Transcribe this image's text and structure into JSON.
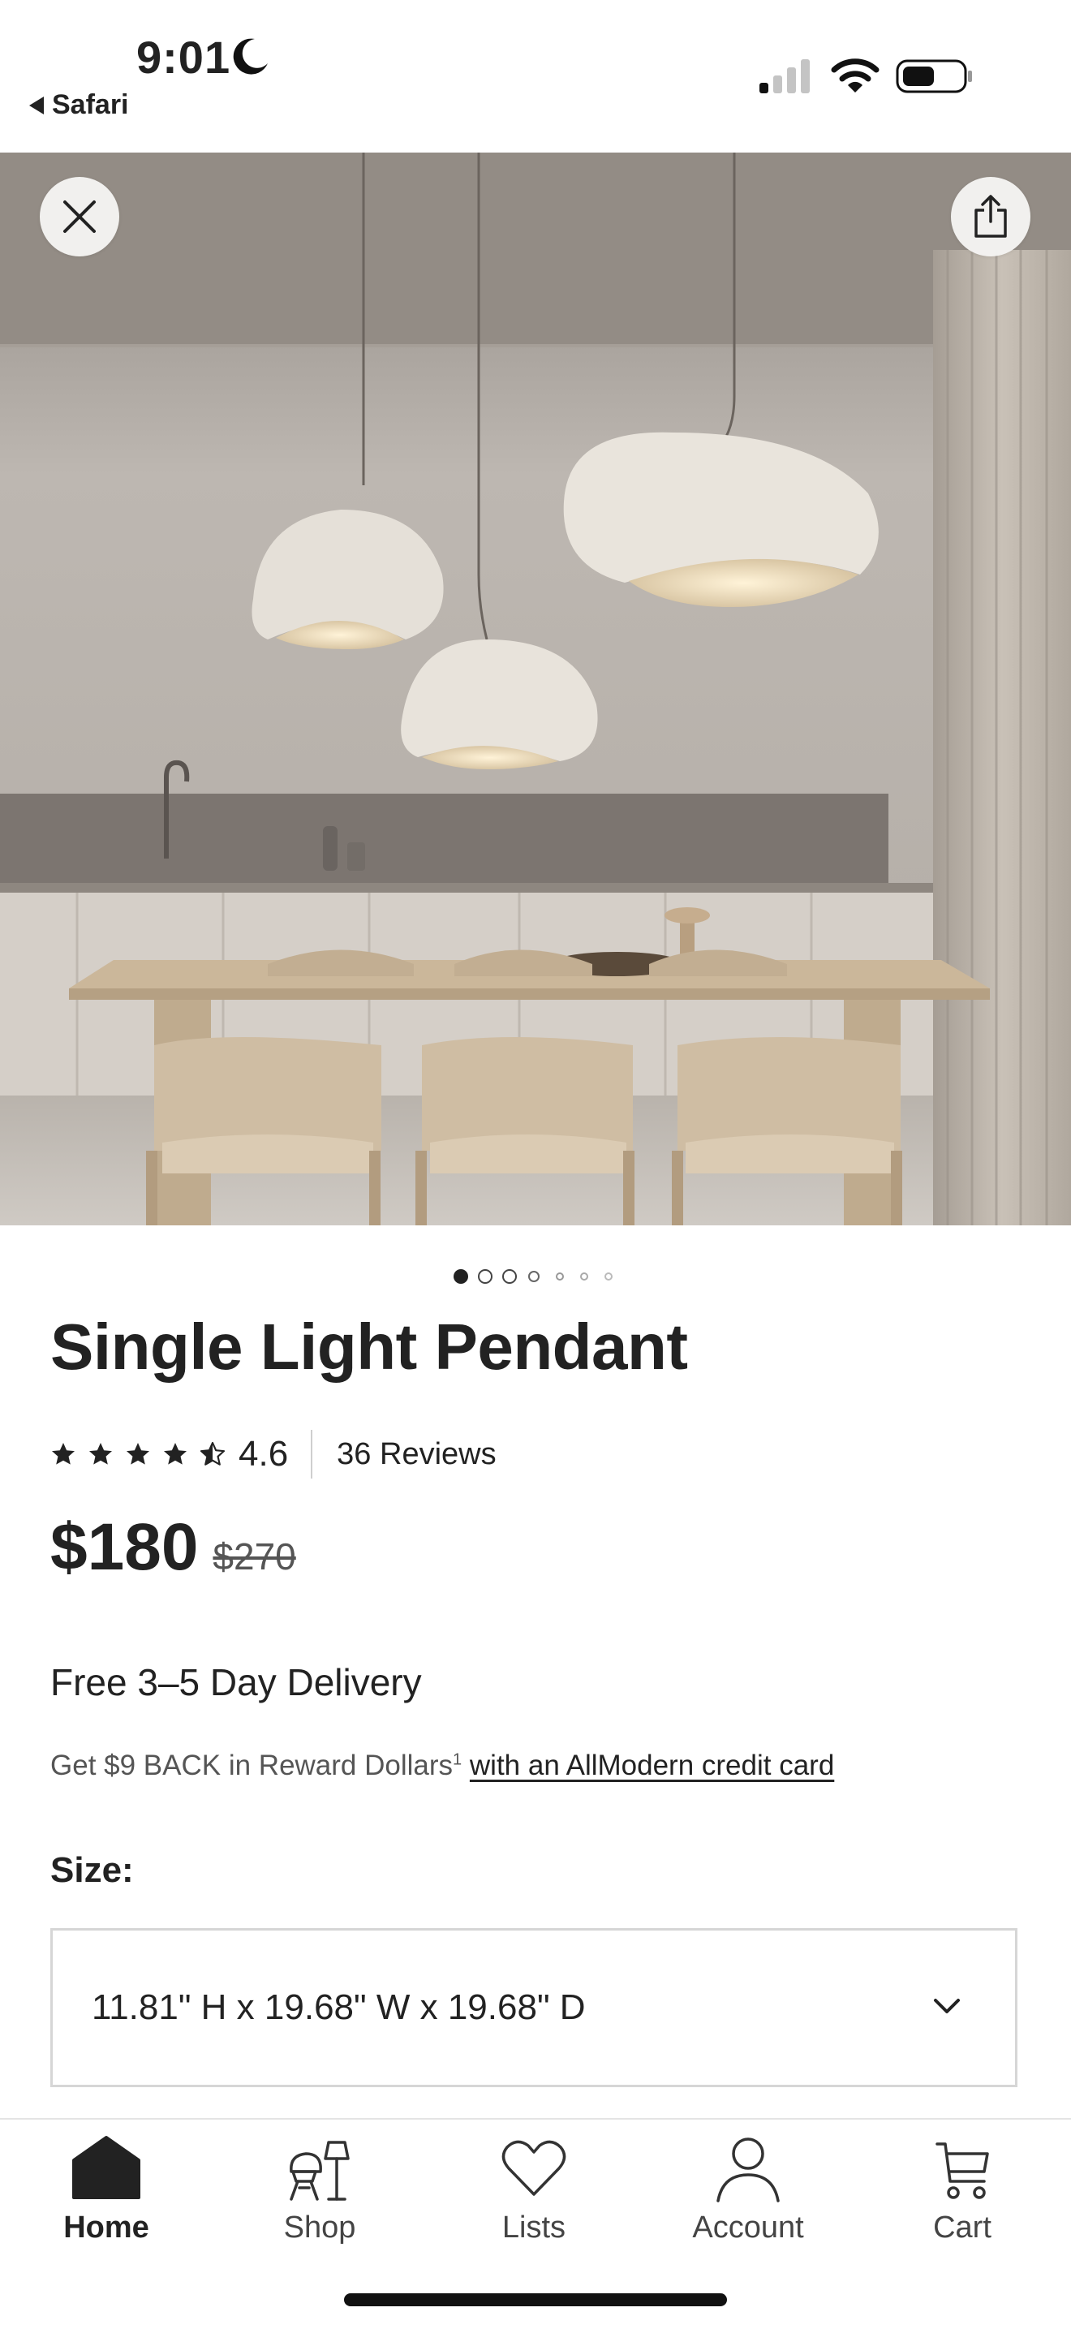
{
  "status_bar": {
    "time": "9:01",
    "back_app": "Safari",
    "icons": [
      "moon-icon",
      "signal-icon",
      "wifi-icon",
      "battery-icon"
    ]
  },
  "hero": {
    "image_description": "dining-room-pendant-lights-photo",
    "close_icon": "close-icon",
    "share_icon": "share-icon",
    "carousel": {
      "total": 7,
      "active_index": 0
    }
  },
  "product": {
    "title": "Single Light Pendant",
    "rating": {
      "stars": 4.5,
      "value": "4.6",
      "reviews_label": "36 Reviews"
    },
    "price": "$180",
    "was_price": "$270",
    "delivery": "Free 3–5 Day Delivery",
    "reward_text": "Get $9 BACK in Reward Dollars",
    "reward_footnote": "1",
    "reward_link": "with an AllModern credit card",
    "size_label": "Size:",
    "size_value": "11.81\" H x 19.68\" W x 19.68\" D"
  },
  "bottom_nav": {
    "items": [
      {
        "label": "Home",
        "icon": "home-icon",
        "active": true
      },
      {
        "label": "Shop",
        "icon": "shop-icon",
        "active": false
      },
      {
        "label": "Lists",
        "icon": "heart-icon",
        "active": false
      },
      {
        "label": "Account",
        "icon": "account-icon",
        "active": false
      },
      {
        "label": "Cart",
        "icon": "cart-icon",
        "active": false
      }
    ]
  },
  "colors": {
    "text": "#222222",
    "muted": "#555555",
    "border": "#d6d6d6",
    "background": "#ffffff"
  }
}
